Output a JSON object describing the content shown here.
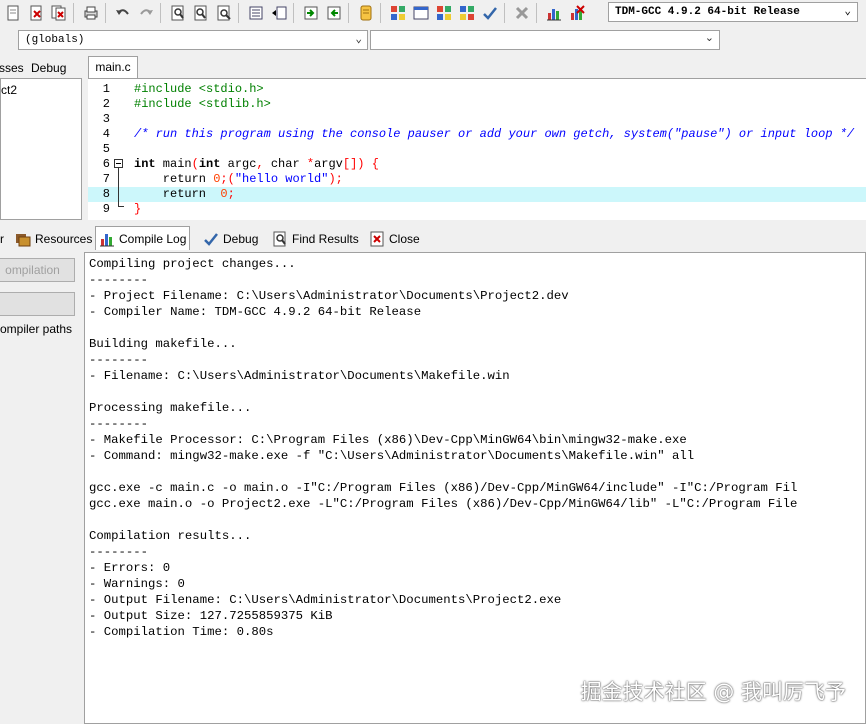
{
  "toolbar": {
    "compiler_select_value": "TDM-GCC 4.9.2 64-bit Release",
    "icons": [
      "new-file-icon",
      "close-file-icon",
      "close-all-icon",
      "print-icon",
      "undo-icon",
      "redo-icon",
      "find-icon",
      "replace-icon",
      "find-next-icon",
      "indent-icon",
      "unindent-icon",
      "goto-line-icon",
      "goto-function-icon",
      "bookmark-icon",
      "compile-icon",
      "run-icon",
      "compile-run-icon",
      "rebuild-icon",
      "syntax-check-icon",
      "stop-icon",
      "profile-icon",
      "delete-profile-icon"
    ]
  },
  "row2": {
    "globals_value": "(globals)",
    "second_value": ""
  },
  "left_panel": {
    "tabs": [
      "sses",
      "Debug"
    ],
    "project_item": "ct2"
  },
  "editor": {
    "tab_label": "main.c",
    "lines": [
      {
        "num": "1",
        "text": "#include <stdio.h>"
      },
      {
        "num": "2",
        "text": "#include <stdlib.h>"
      },
      {
        "num": "3",
        "text": ""
      },
      {
        "num": "4",
        "text": "/* run this program using the console pauser or add your own getch, system(\"pause\") or input loop */"
      },
      {
        "num": "5",
        "text": ""
      },
      {
        "num": "6",
        "text": "int main(int argc, char *argv[]) {"
      },
      {
        "num": "7",
        "text": "    return 0;(\"hello world\");"
      },
      {
        "num": "8",
        "text": "    return  0;"
      },
      {
        "num": "9",
        "text": "}"
      }
    ],
    "current_line": 8
  },
  "bottom_tabs": [
    {
      "label": "r",
      "icon": "compiler-icon"
    },
    {
      "label": "Resources",
      "icon": "resources-icon"
    },
    {
      "label": "Compile Log",
      "icon": "compile-log-icon"
    },
    {
      "label": "Debug",
      "icon": "debug-check-icon"
    },
    {
      "label": "Find Results",
      "icon": "find-results-icon"
    },
    {
      "label": "Close",
      "icon": "close-icon"
    }
  ],
  "bottom_left": {
    "button1": "ompilation",
    "button2": "",
    "label": "ompiler paths"
  },
  "log": {
    "text": "Compiling project changes...\n--------\n- Project Filename: C:\\Users\\Administrator\\Documents\\Project2.dev\n- Compiler Name: TDM-GCC 4.9.2 64-bit Release\n\nBuilding makefile...\n--------\n- Filename: C:\\Users\\Administrator\\Documents\\Makefile.win\n\nProcessing makefile...\n--------\n- Makefile Processor: C:\\Program Files (x86)\\Dev-Cpp\\MinGW64\\bin\\mingw32-make.exe\n- Command: mingw32-make.exe -f \"C:\\Users\\Administrator\\Documents\\Makefile.win\" all\n\ngcc.exe -c main.c -o main.o -I\"C:/Program Files (x86)/Dev-Cpp/MinGW64/include\" -I\"C:/Program Fil\ngcc.exe main.o -o Project2.exe -L\"C:/Program Files (x86)/Dev-Cpp/MinGW64/lib\" -L\"C:/Program File\n\nCompilation results...\n--------\n- Errors: 0\n- Warnings: 0\n- Output Filename: C:\\Users\\Administrator\\Documents\\Project2.exe\n- Output Size: 127.7255859375 KiB\n- Compilation Time: 0.80s"
  },
  "watermark": "掘金技术社区 @ 我叫厉飞予"
}
